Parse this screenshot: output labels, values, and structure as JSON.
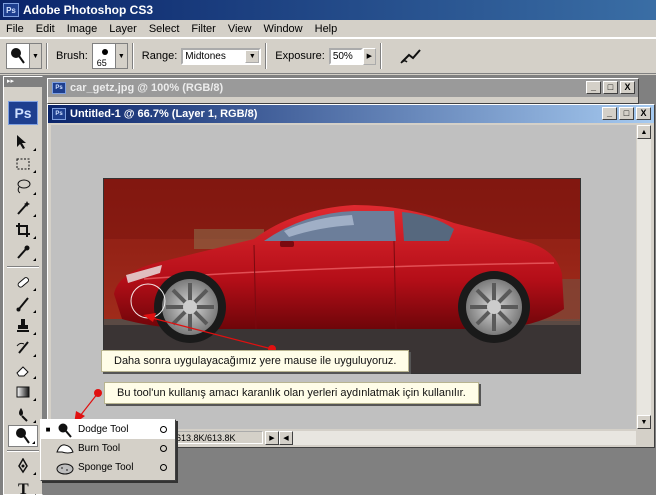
{
  "app": {
    "title": "Adobe Photoshop CS3",
    "logo_text": "Ps"
  },
  "menu": [
    "File",
    "Edit",
    "Image",
    "Layer",
    "Select",
    "Filter",
    "View",
    "Window",
    "Help"
  ],
  "options": {
    "brush_label": "Brush:",
    "brush_size": "65",
    "range_label": "Range:",
    "range_value": "Midtones",
    "exposure_label": "Exposure:",
    "exposure_value": "50%"
  },
  "toolbox": {
    "logo_text": "Ps"
  },
  "doc_back": {
    "title": "car_getz.jpg @ 100% (RGB/8)"
  },
  "doc_front": {
    "title": "Untitled-1 @ 66.7% (Layer 1, RGB/8)",
    "status": "Doc: 613.8K/613.8K"
  },
  "window_buttons": {
    "minimize": "_",
    "maximize": "□",
    "close": "X"
  },
  "callouts": {
    "one": "Daha sonra uygulayacağımız yere mause ile uyguluyoruz.",
    "two": "Bu tool'un kullanış amacı karanlık olan yerleri aydınlatmak için kullanılır."
  },
  "flyout": {
    "items": [
      {
        "label": "Dodge Tool",
        "selected": true
      },
      {
        "label": "Burn Tool",
        "selected": false
      },
      {
        "label": "Sponge Tool",
        "selected": false
      }
    ],
    "selected_mark": "■"
  },
  "colors": {
    "accent": "#0a246a",
    "callout_arrow": "#e01010",
    "car": "#c4101c"
  }
}
